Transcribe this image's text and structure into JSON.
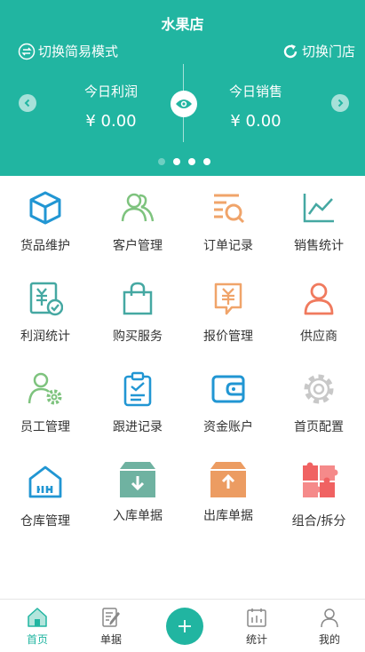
{
  "header": {
    "store_name": "水果店",
    "mode_switch": "切换简易模式",
    "store_switch": "切换门店",
    "stats": [
      {
        "label": "今日利润",
        "value": "¥ 0.00"
      },
      {
        "label": "今日销售",
        "value": "¥ 0.00"
      }
    ],
    "carousel_pages": 4,
    "carousel_active": 1
  },
  "menu": [
    {
      "label": "货品维护",
      "icon": "cube-icon",
      "color": "#2196d3"
    },
    {
      "label": "客户管理",
      "icon": "users-icon",
      "color": "#7ec37e"
    },
    {
      "label": "订单记录",
      "icon": "order-search-icon",
      "color": "#f0a46a"
    },
    {
      "label": "销售统计",
      "icon": "line-chart-icon",
      "color": "#45a8a2"
    },
    {
      "label": "利润统计",
      "icon": "profit-doc-icon",
      "color": "#45a8a2"
    },
    {
      "label": "购买服务",
      "icon": "shopping-bag-icon",
      "color": "#45a8a2"
    },
    {
      "label": "报价管理",
      "icon": "quote-yen-icon",
      "color": "#f0a46a"
    },
    {
      "label": "供应商",
      "icon": "supplier-person-icon",
      "color": "#f07a5e"
    },
    {
      "label": "员工管理",
      "icon": "staff-gear-icon",
      "color": "#7ec37e"
    },
    {
      "label": "跟进记录",
      "icon": "clipboard-check-icon",
      "color": "#2196d3"
    },
    {
      "label": "资金账户",
      "icon": "wallet-icon",
      "color": "#2196d3"
    },
    {
      "label": "首页配置",
      "icon": "gear-icon",
      "color": "#c8c8c8"
    },
    {
      "label": "仓库管理",
      "icon": "warehouse-icon",
      "color": "#2196d3"
    },
    {
      "label": "入库单据",
      "icon": "inbound-box-icon",
      "color": "#45a8a2"
    },
    {
      "label": "出库单据",
      "icon": "outbound-box-icon",
      "color": "#f0a46a"
    },
    {
      "label": "组合/拆分",
      "icon": "puzzle-icon",
      "color": "#f06262"
    }
  ],
  "tabbar": {
    "home": "首页",
    "docs": "单据",
    "stats": "统计",
    "mine": "我的"
  },
  "colors": {
    "brand": "#21b5a1"
  }
}
